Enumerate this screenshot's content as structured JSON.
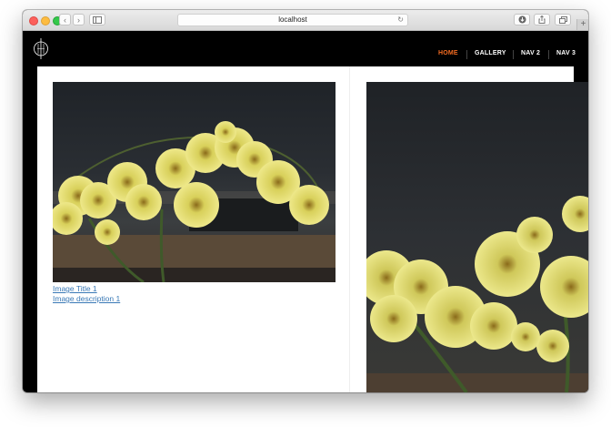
{
  "browser": {
    "url": "localhost",
    "buttons": [
      "back",
      "forward",
      "sidebar",
      "reload",
      "downloads",
      "share",
      "tabs",
      "new-tab"
    ]
  },
  "site": {
    "nav": [
      {
        "label": "HOME",
        "active": true
      },
      {
        "label": "GALLERY",
        "active": false
      },
      {
        "label": "NAV 2",
        "active": false
      },
      {
        "label": "NAV 3",
        "active": false
      }
    ],
    "accent_color": "#f36b21"
  },
  "gallery": {
    "items": [
      {
        "title": "Image Title 1",
        "description": "Image description 1"
      }
    ]
  }
}
